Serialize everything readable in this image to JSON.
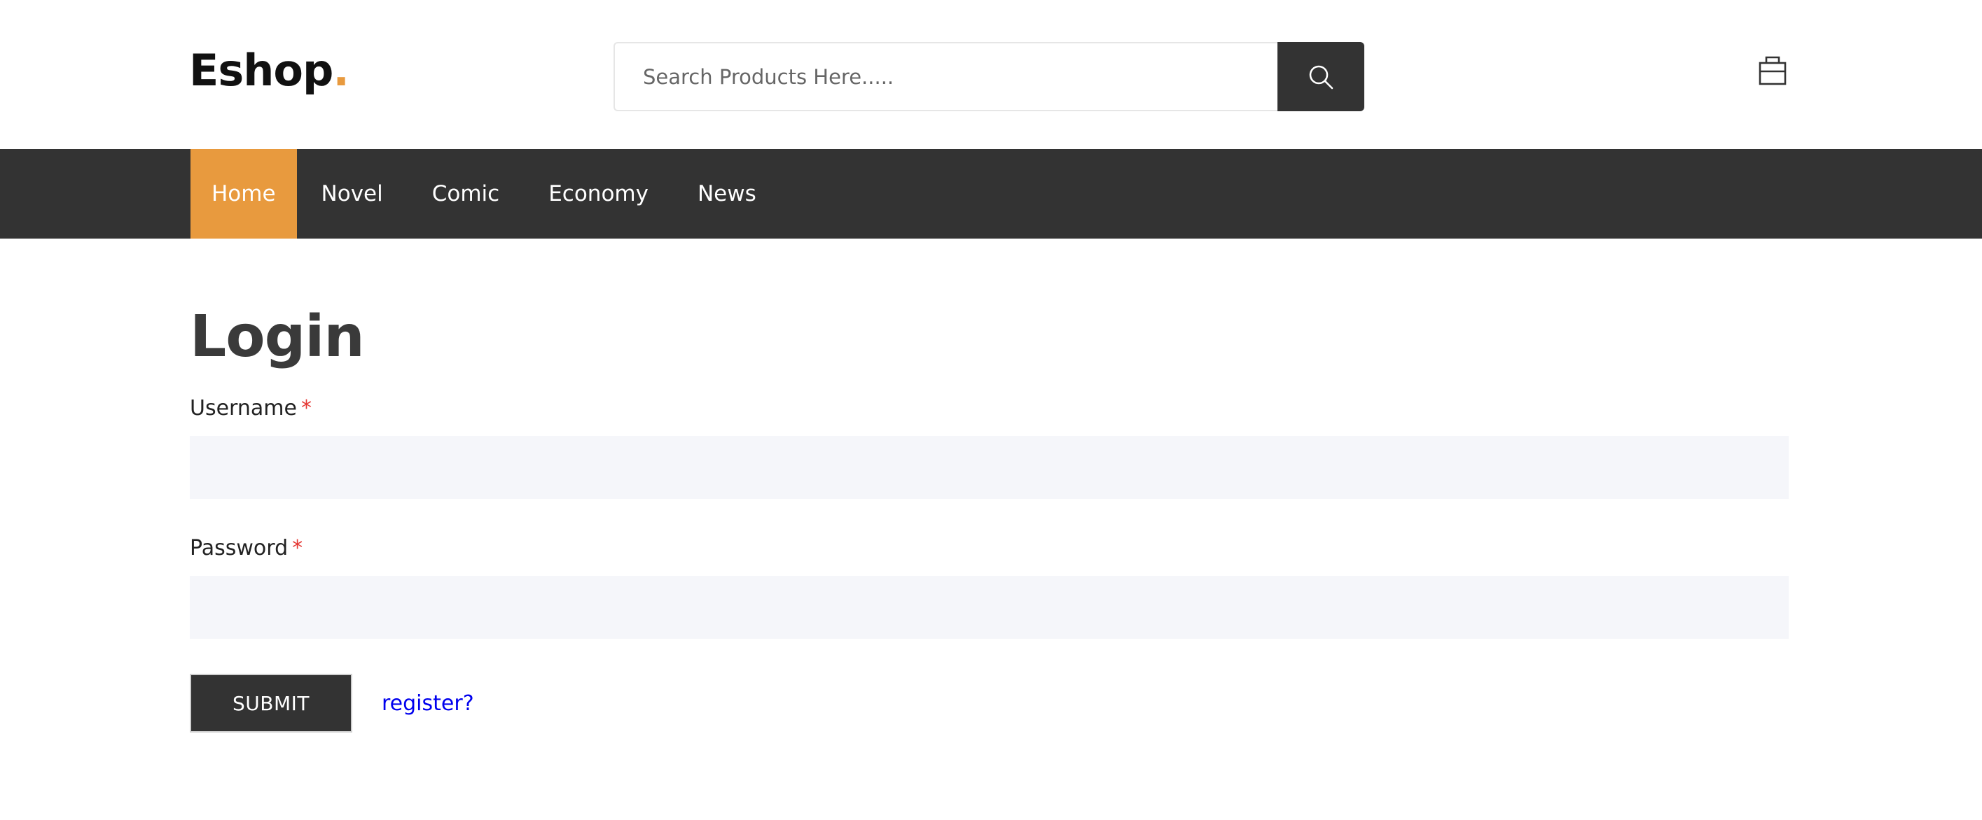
{
  "header": {
    "logo_text": "Eshop",
    "logo_dot": ".",
    "search": {
      "placeholder": "Search Products Here.....",
      "value": ""
    },
    "icons": {
      "search": "search-icon",
      "cart": "shopping-bag-icon"
    }
  },
  "nav": {
    "items": [
      {
        "label": "Home",
        "active": true
      },
      {
        "label": "Novel",
        "active": false
      },
      {
        "label": "Comic",
        "active": false
      },
      {
        "label": "Economy",
        "active": false
      },
      {
        "label": "News",
        "active": false
      }
    ]
  },
  "main": {
    "title": "Login",
    "username": {
      "label": "Username",
      "required_mark": "*",
      "value": ""
    },
    "password": {
      "label": "Password",
      "required_mark": "*",
      "value": ""
    },
    "submit_label": "SUBMIT",
    "register_link": "register?"
  },
  "colors": {
    "accent": "#e89a3e",
    "dark": "#333333",
    "input_bg": "#f5f6fa",
    "link": "#0000ee",
    "required": "#e53935"
  }
}
